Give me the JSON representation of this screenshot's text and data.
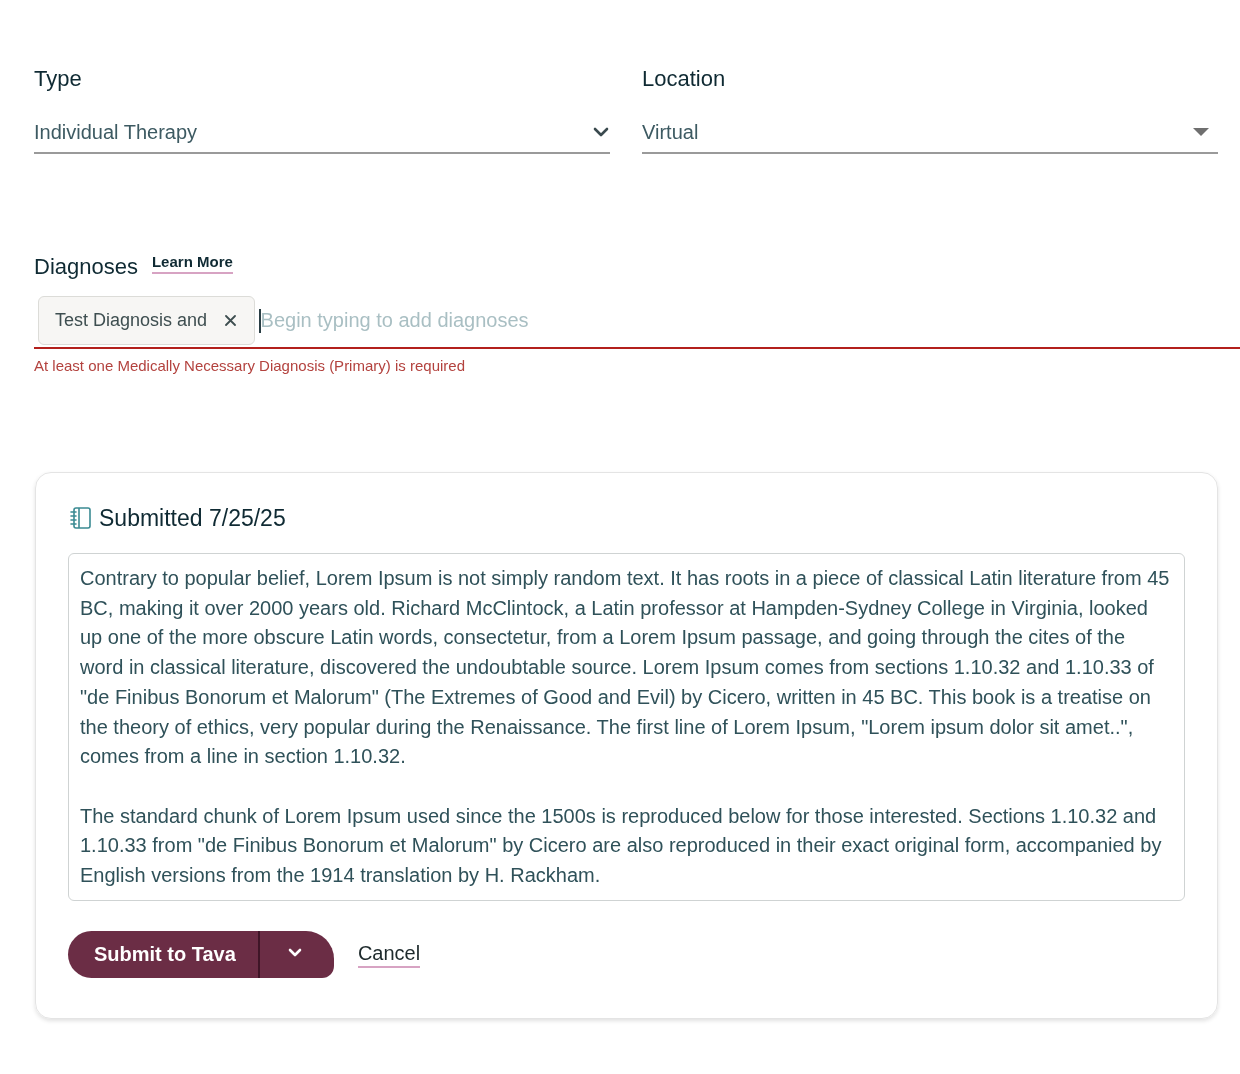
{
  "fields": [
    {
      "label": "Type",
      "value": "Individual Therapy",
      "kind": "chevron"
    },
    {
      "label": "Location",
      "value": "Virtual",
      "kind": "triangle"
    }
  ],
  "diagnoses": {
    "label": "Diagnoses",
    "link": "Learn More",
    "chips": [
      {
        "label": "Test Diagnosis and"
      }
    ],
    "placeholder": "Begin typing to add diagnoses",
    "focused": true,
    "error": "At least one Medically Necessary Diagnosis (Primary) is required"
  },
  "submission": {
    "title": "Submitted 7/25/25",
    "notes": "Contrary to popular belief, Lorem Ipsum is not simply random text. It has roots in a piece of classical Latin literature from 45 BC, making it over 2000 years old. Richard McClintock, a Latin professor at Hampden-Sydney College in Virginia, looked up one of the more obscure Latin words, consectetur, from a Lorem Ipsum passage, and going through the cites of the word in classical literature, discovered the undoubtable source. Lorem Ipsum comes from sections 1.10.32 and 1.10.33 of \"de Finibus Bonorum et Malorum\" (The Extremes of Good and Evil) by Cicero, written in 45 BC. This book is a treatise on the theory of ethics, very popular during the Renaissance. The first line of Lorem Ipsum, \"Lorem ipsum dolor sit amet..\", comes from a line in section 1.10.32.\n\nThe standard chunk of Lorem Ipsum used since the 1500s is reproduced below for those interested. Sections 1.10.32 and 1.10.33 from \"de Finibus Bonorum et Malorum\" by Cicero are also reproduced in their exact original form, accompanied by English versions from the 1914 translation by H. Rackham.",
    "primary_button": "Submit to Tava",
    "cancel_link": "Cancel"
  }
}
